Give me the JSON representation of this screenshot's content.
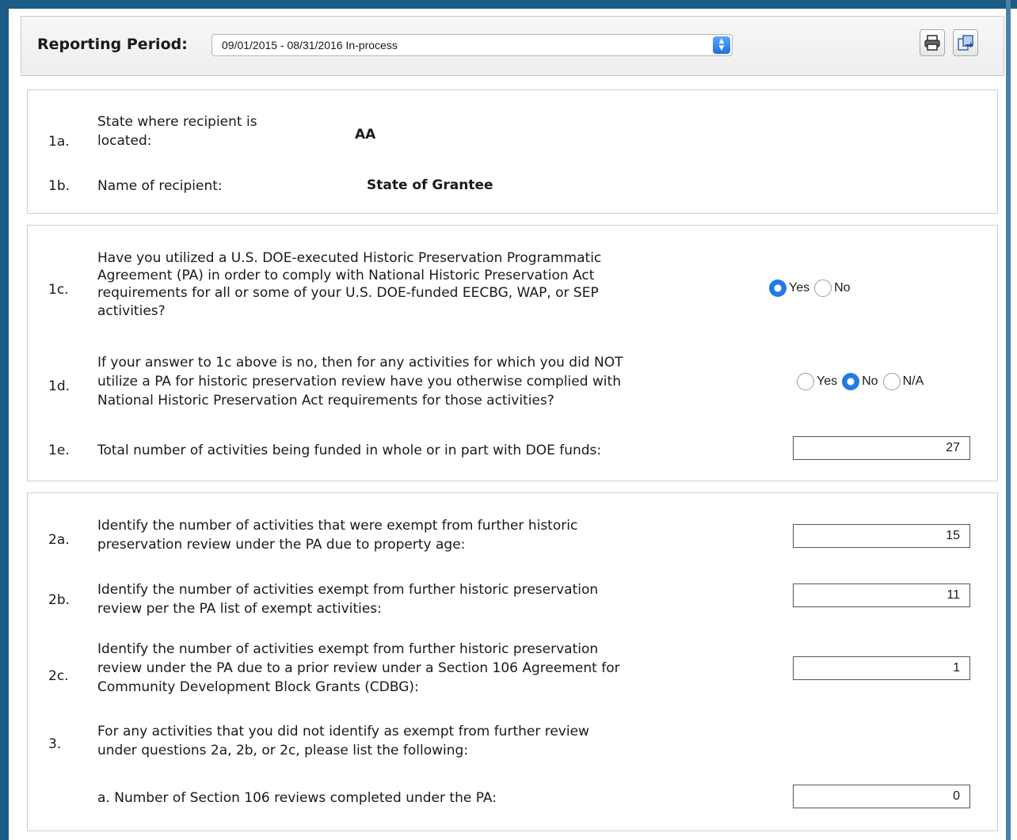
{
  "header": {
    "reporting_period_label": "Reporting Period:",
    "reporting_period_value": "09/01/2015 - 08/31/2016 In-process",
    "print_icon": "printer-icon",
    "export_icon": "export-document-icon"
  },
  "section1": {
    "q1a": {
      "num": "1a.",
      "text_line1": "State where recipient is",
      "text_line2": "located:",
      "value": "AA"
    },
    "q1b": {
      "num": "1b.",
      "text": "Name of recipient:",
      "value": "State of Grantee"
    }
  },
  "section2": {
    "q1c": {
      "num": "1c.",
      "lines": [
        "Have you utilized a U.S. DOE-executed Historic Preservation Programmatic",
        "Agreement (PA) in order to comply with National Historic Preservation Act",
        "requirements for all or some of your U.S. DOE-funded EECBG, WAP, or SEP",
        "activities?"
      ],
      "options": [
        "Yes",
        "No"
      ],
      "selected": "Yes"
    },
    "q1d": {
      "num": "1d.",
      "lines": [
        "If your answer to 1c above is no, then for any activities for which you did NOT",
        "utilize a PA for historic preservation review have you otherwise complied with",
        "National Historic Preservation Act requirements for those activities?"
      ],
      "options": [
        "Yes",
        "No",
        "N/A"
      ],
      "selected": "No"
    },
    "q1e": {
      "num": "1e.",
      "text": "Total number of activities being funded in whole or in part with DOE funds:",
      "value": "27"
    }
  },
  "section3": {
    "q2a": {
      "num": "2a.",
      "lines": [
        "Identify the number of activities that were exempt from further historic",
        "preservation review under the PA due to property age:"
      ],
      "value": "15"
    },
    "q2b": {
      "num": "2b.",
      "lines": [
        "Identify the number of activities exempt from further historic preservation",
        "review per the PA list of exempt activities:"
      ],
      "value": "11"
    },
    "q2c": {
      "num": "2c.",
      "lines": [
        "Identify the number of activities exempt from further historic preservation",
        "review under the PA due to a prior review under a Section 106 Agreement for",
        "Community Development Block Grants (CDBG):"
      ],
      "value": "1"
    },
    "q3": {
      "num": "3.",
      "lines": [
        "For any activities that you did not identify as exempt from further review",
        "under questions 2a, 2b, or 2c, please list the following:"
      ]
    },
    "q3a": {
      "text": "a. Number of Section 106 reviews completed under the PA:",
      "value": "0"
    }
  }
}
